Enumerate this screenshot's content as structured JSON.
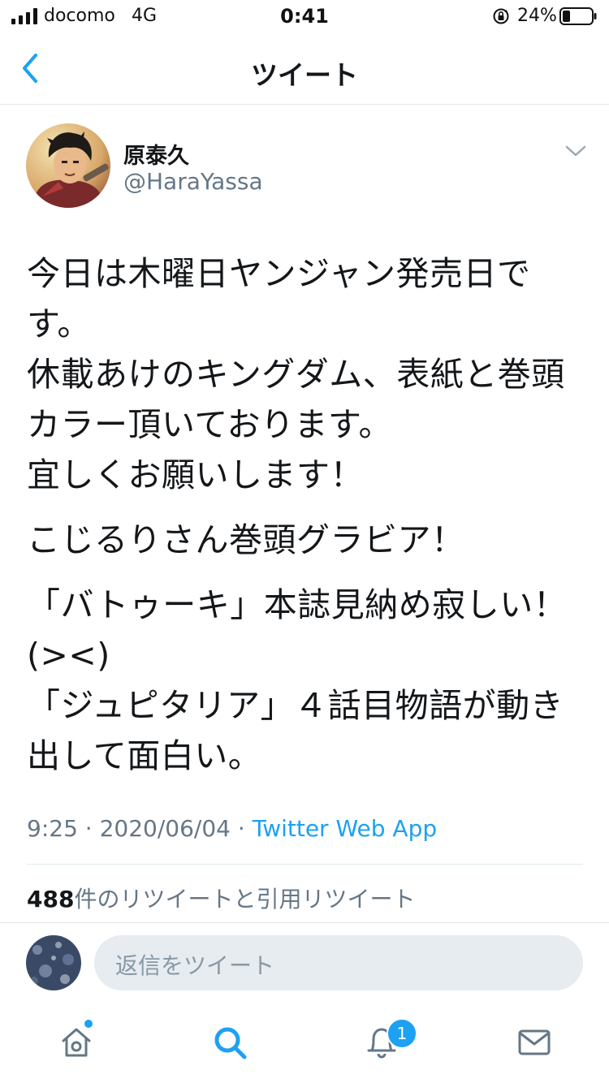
{
  "status_bar": {
    "carrier": "docomo",
    "network": "4G",
    "time": "0:41",
    "battery_percent": "24%"
  },
  "nav": {
    "title": "ツイート",
    "back_icon": "chevron-left-icon"
  },
  "tweet": {
    "display_name": "原泰久",
    "handle": "@HaraYassa",
    "lines": [
      "今日は木曜日ヤンジャン発売日で",
      "す。",
      "休載あけのキングダム、表紙と巻頭",
      "カラー頂いております。",
      "宜しくお願いします！",
      "こじるりさん巻頭グラビア！",
      "「バトゥーキ」本誌見納め寂しい！",
      "(><)",
      "「ジュピタリア」４話目物語が動き",
      "出して面白い。"
    ],
    "time": "9:25",
    "date": "2020/06/04",
    "separator": "·",
    "source": "Twitter Web App",
    "retweet_count": "488",
    "retweet_label": "件のリツイートと引用リツイート"
  },
  "reply": {
    "placeholder": "返信をツイート"
  },
  "tab_bar": {
    "notification_badge": "1",
    "icons": [
      "home-icon",
      "search-icon",
      "bell-icon",
      "mail-icon"
    ]
  },
  "colors": {
    "accent": "#1da1f2",
    "text": "#14171a",
    "secondary": "#657786",
    "divider": "#e1e8ed"
  }
}
